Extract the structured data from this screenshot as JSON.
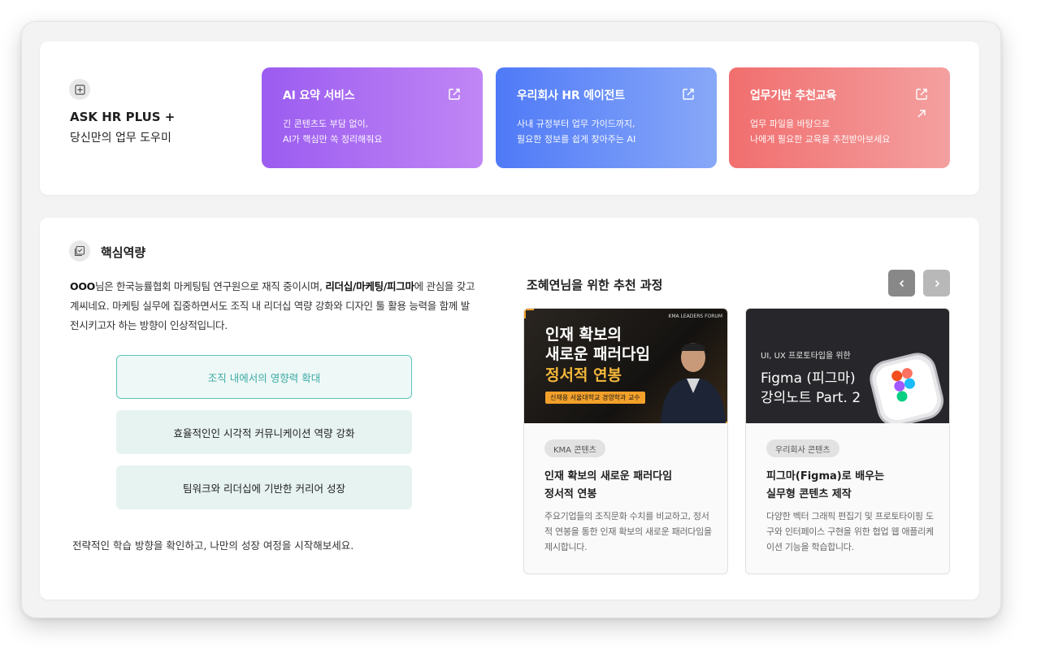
{
  "hr": {
    "title": "ASK HR PLUS +",
    "subtitle": "당신만의 업무 도우미",
    "icon": "plus-square-icon"
  },
  "services": [
    {
      "title": "AI 요약 서비스",
      "desc": "긴 콘텐츠도 부담 없이,\n AI가 핵심만 쏙 정리해줘요",
      "gradient": [
        "#9b5cf0",
        "#c086f5"
      ],
      "icon": "external-link-icon"
    },
    {
      "title": "우리회사 HR 에이전트",
      "desc": "사내 규정부터 업무 가이드까지,\n필요한 정보를 쉽게 찾아주는 AI",
      "gradient": [
        "#4f7af7",
        "#88a8f8"
      ],
      "icon": "external-link-icon"
    },
    {
      "title": "업무기반 추천교육",
      "desc": "업무 파일을 바탕으로\n 나에게 필요한 교육을 추천받아보세요",
      "gradient": [
        "#f16e6e",
        "#f4a0a0"
      ],
      "icon": "external-link-icon"
    }
  ],
  "competency": {
    "title": "핵심역량",
    "icon": "checklist-icon",
    "intro_name": "OOO",
    "intro_part1": "님은 한국능률협회 마케팅팀 연구원으로 재직 중이시며, ",
    "intro_bold": "리더십/마케팅/피그마",
    "intro_part2": "에 관심을 갖고 계씨네요. 마케팅 실무에 집중하면서도 조직 내 리더십 역량 강화와 디자인 툴 활용 능력을 함께 발전시키고자 하는 방향이 인상적입니다.",
    "items": [
      {
        "label": "조직 내에서의 영향력 확대",
        "active": true
      },
      {
        "label": "효율적인인 시각적 커뮤니케이션 역량 강화",
        "active": false
      },
      {
        "label": "팀워크와 리더십에 기반한 커리어 성장",
        "active": false
      }
    ],
    "outro": "전략적인 학습 방향을 확인하고, 나만의 성장 여정을 시작해보세요."
  },
  "recommend": {
    "title": "조혜연님을 위한 추천 과정",
    "prev_icon": "chevron-left-icon",
    "next_icon": "chevron-right-icon",
    "courses": [
      {
        "thumb_forum": "KMA LEADERS FORUM",
        "thumb_line1": "인재 확보의",
        "thumb_line2": "새로운 패러다임",
        "thumb_line3": "정서적 연봉",
        "thumb_caption": "신재용 서울대학교 경영학과 교수",
        "badge": "KMA 콘텐츠",
        "title_line1": "인재 확보의 새로운 패러다임",
        "title_line2": "정서적 연봉",
        "desc": "주요기업들의 조직문화 수치를 비교하고, 정서적 연봉을 통한 인재 확보의 새로운 패러다임을 제시합니다."
      },
      {
        "thumb_small": "UI, UX 프로토타입을 위한",
        "thumb_line1": "Figma (피그마)",
        "thumb_line2": "강의노트 Part. 2",
        "badge": "우리회사 콘텐츠",
        "title_line1": "피그마(Figma)로 배우는",
        "title_line2": "실무형 콘텐츠 제작",
        "desc": "다양한 벡터 그래픽 편집기 및 프로토타이핑 도구와 인터페이스 구현을 위한 협업 웹 애플리케이션 기능을 학습합니다."
      }
    ]
  }
}
